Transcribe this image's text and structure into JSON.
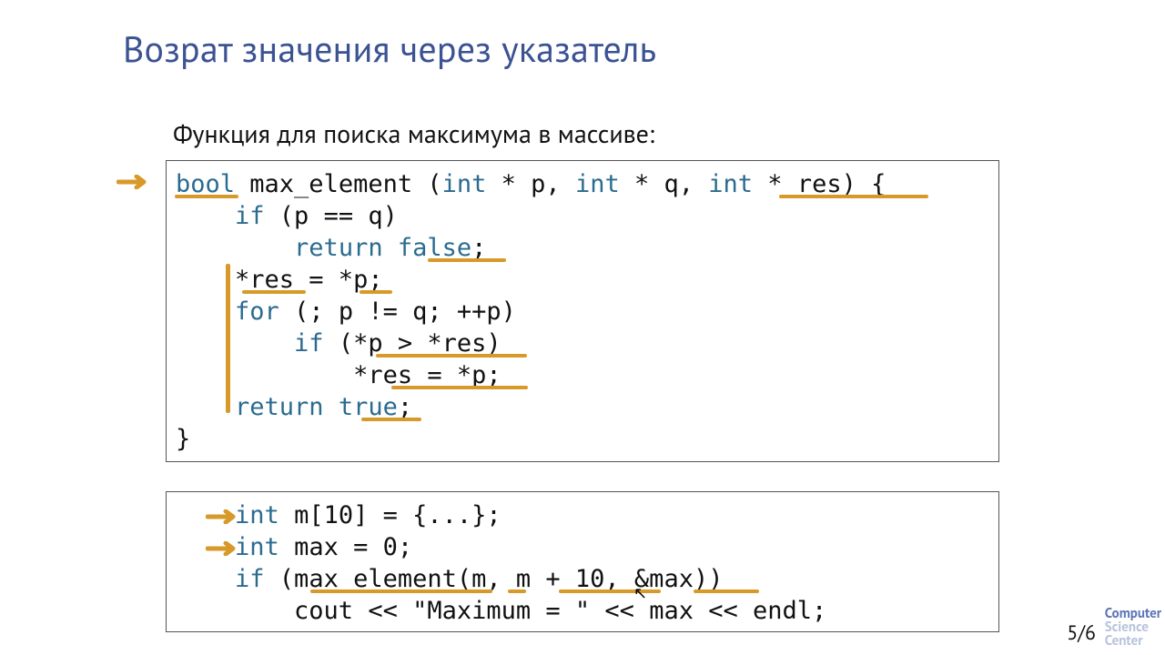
{
  "title": "Возрат значения через указатель",
  "subtitle": "Функция для поиска максимума в массиве:",
  "code1": {
    "l1a": "bool",
    "l1b": " max_element (",
    "l1c": "int",
    "l1d": " * p, ",
    "l1e": "int",
    "l1f": " * q, ",
    "l1g": "int",
    "l1h": " * res) {",
    "l2a": "    ",
    "l2b": "if",
    "l2c": " (p == q)",
    "l3a": "        ",
    "l3b": "return",
    "l3c": " ",
    "l3d": "false",
    "l3e": ";",
    "l4": "    *res = *p;",
    "l5a": "    ",
    "l5b": "for",
    "l5c": " (; p != q; ++p)",
    "l6a": "        ",
    "l6b": "if",
    "l6c": " (*p > *res)",
    "l7": "            *res = *p;",
    "l8a": "    ",
    "l8b": "return",
    "l8c": " ",
    "l8d": "true",
    "l8e": ";",
    "l9": "}"
  },
  "code2": {
    "l1a": "    ",
    "l1b": "int",
    "l1c": " m[10] = {...};",
    "l2a": "    ",
    "l2b": "int",
    "l2c": " max = 0;",
    "l3a": "    ",
    "l3b": "if",
    "l3c": " (max_element(m, m + 10, &max))",
    "l4a": "        cout << ",
    "l4b": "\"Maximum = \"",
    "l4c": " << max << endl;"
  },
  "page": "5/6",
  "logo": {
    "l1": "Computer",
    "l2": "Science",
    "l3": "Center"
  }
}
